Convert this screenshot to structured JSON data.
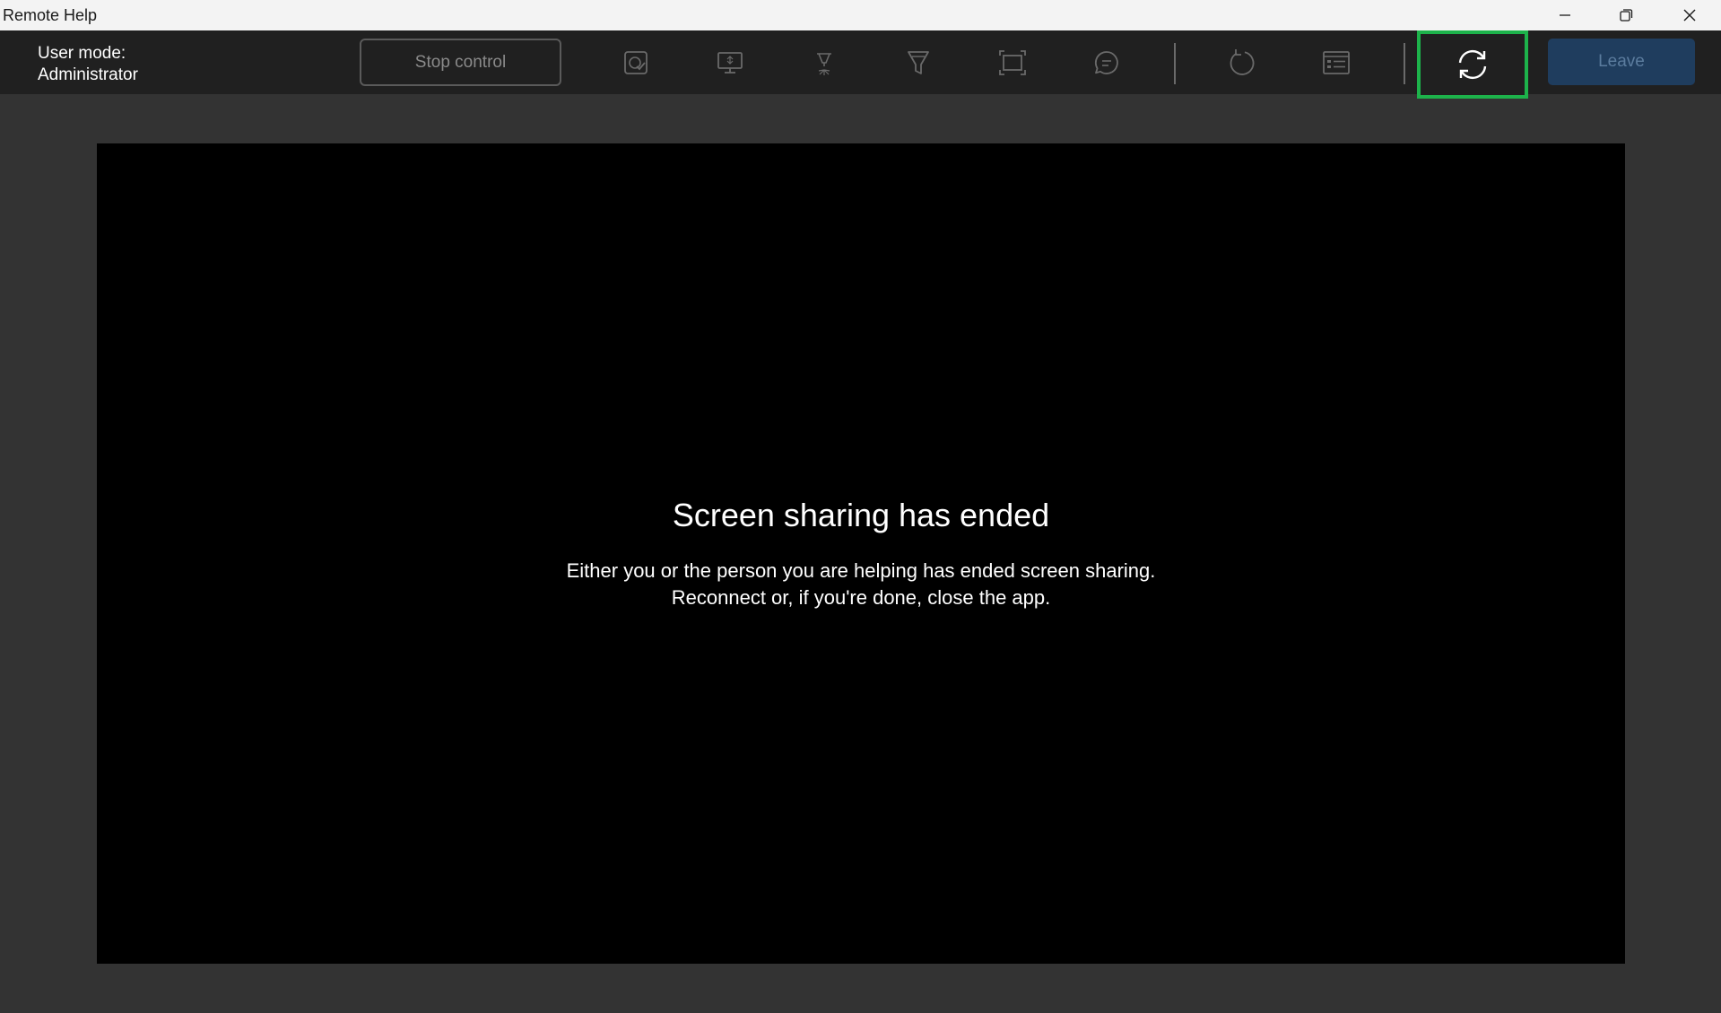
{
  "window": {
    "title": "Remote Help"
  },
  "toolbar": {
    "user_mode_label": "User mode:",
    "user_mode_value": "Administrator",
    "stop_control_label": "Stop control",
    "leave_label": "Leave",
    "icons": [
      "app-check-icon",
      "monitor-icon",
      "laser-pointer-icon",
      "highlighter-icon",
      "full-screen-icon",
      "chat-icon",
      "restart-icon",
      "details-icon",
      "reconnect-icon"
    ],
    "highlight_color": "#1db34b"
  },
  "main": {
    "title": "Screen sharing has ended",
    "line1": "Either you or the person you are helping has ended screen sharing.",
    "line2": "Reconnect or, if you're done, close the app."
  }
}
